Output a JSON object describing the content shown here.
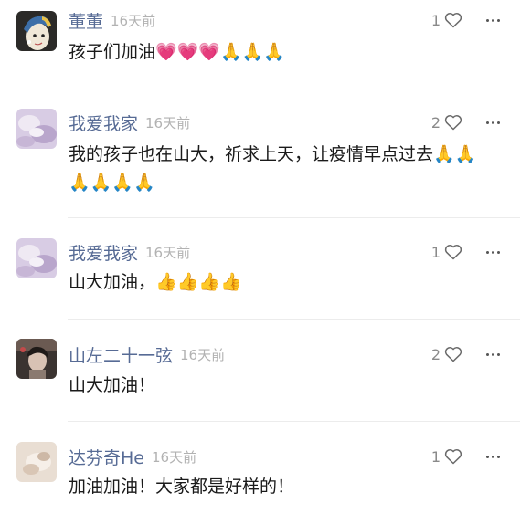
{
  "comments": [
    {
      "username": "董董",
      "time": "16天前",
      "likes": "1",
      "content": "孩子们加油💗💗💗🙏🙏🙏",
      "avatar_icon": "pearl-earring-girl-avatar"
    },
    {
      "username": "我爱我家",
      "time": "16天前",
      "likes": "2",
      "content": "我的孩子也在山大，祈求上天，让疫情早点过去🙏🙏🙏🙏🙏🙏",
      "avatar_icon": "lavender-photo-avatar"
    },
    {
      "username": "我爱我家",
      "time": "16天前",
      "likes": "1",
      "content": "山大加油，👍👍👍👍",
      "avatar_icon": "lavender-photo-avatar"
    },
    {
      "username": "山左二十一弦",
      "time": "16天前",
      "likes": "2",
      "content": "山大加油！",
      "avatar_icon": "portrait-photo-avatar"
    },
    {
      "username": "达芬奇He",
      "time": "16天前",
      "likes": "1",
      "content": "加油加油！大家都是好样的！",
      "avatar_icon": "beige-photo-avatar"
    }
  ],
  "colors": {
    "username": "#576b95",
    "time": "#b2b2b2",
    "divider": "#ececec"
  }
}
